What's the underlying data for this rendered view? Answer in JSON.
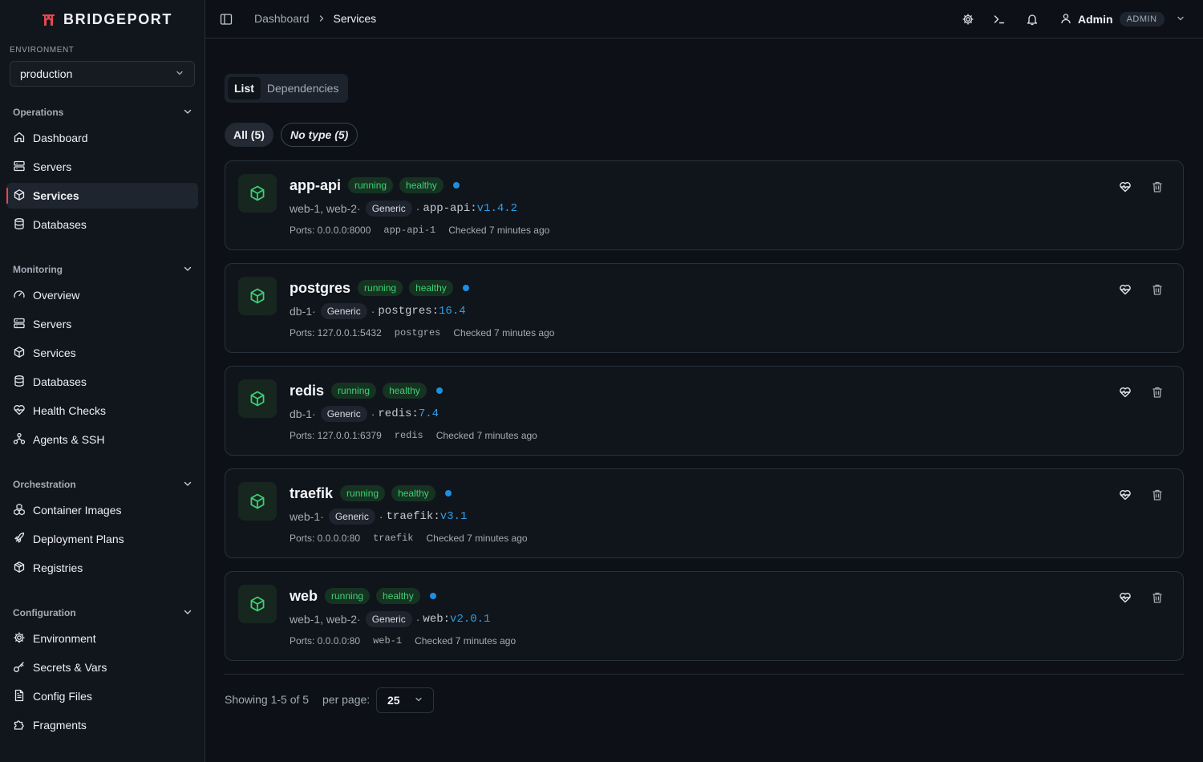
{
  "app": {
    "name": "BRIDGEPORT"
  },
  "environment": {
    "label": "ENVIRONMENT",
    "value": "production"
  },
  "sidebar": {
    "groups": [
      {
        "title": "Operations",
        "items": [
          "Dashboard",
          "Servers",
          "Services",
          "Databases"
        ]
      },
      {
        "title": "Monitoring",
        "items": [
          "Overview",
          "Servers",
          "Services",
          "Databases",
          "Health Checks",
          "Agents & SSH"
        ]
      },
      {
        "title": "Orchestration",
        "items": [
          "Container Images",
          "Deployment Plans",
          "Registries"
        ]
      },
      {
        "title": "Configuration",
        "items": [
          "Environment",
          "Secrets & Vars",
          "Config Files",
          "Fragments"
        ]
      }
    ],
    "active_item": "Services"
  },
  "header": {
    "breadcrumb": [
      "Dashboard",
      "Services"
    ],
    "user": {
      "name": "Admin",
      "role": "ADMIN"
    }
  },
  "view_tabs": [
    "List",
    "Dependencies"
  ],
  "filters": {
    "all": "All (5)",
    "no_type": "No type (5)"
  },
  "services": [
    {
      "name": "app-api",
      "status": "running",
      "health": "healthy",
      "servers": "web-1, web-2",
      "type": "Generic",
      "image": "app-api",
      "tag": "v1.4.2",
      "ports": "Ports: 0.0.0.0:8000",
      "container": "app-api-1",
      "checked": "Checked 7 minutes ago"
    },
    {
      "name": "postgres",
      "status": "running",
      "health": "healthy",
      "servers": "db-1",
      "type": "Generic",
      "image": "postgres",
      "tag": "16.4",
      "ports": "Ports: 127.0.0.1:5432",
      "container": "postgres",
      "checked": "Checked 7 minutes ago"
    },
    {
      "name": "redis",
      "status": "running",
      "health": "healthy",
      "servers": "db-1",
      "type": "Generic",
      "image": "redis",
      "tag": "7.4",
      "ports": "Ports: 127.0.0.1:6379",
      "container": "redis",
      "checked": "Checked 7 minutes ago"
    },
    {
      "name": "traefik",
      "status": "running",
      "health": "healthy",
      "servers": "web-1",
      "type": "Generic",
      "image": "traefik",
      "tag": "v3.1",
      "ports": "Ports: 0.0.0.0:80",
      "container": "traefik",
      "checked": "Checked 7 minutes ago"
    },
    {
      "name": "web",
      "status": "running",
      "health": "healthy",
      "servers": "web-1, web-2",
      "type": "Generic",
      "image": "web",
      "tag": "v2.0.1",
      "ports": "Ports: 0.0.0.0:80",
      "container": "web-1",
      "checked": "Checked 7 minutes ago"
    }
  ],
  "pagination": {
    "showing": "Showing 1-5 of 5",
    "per_page_label": "per page:",
    "per_page_value": "25"
  },
  "colors": {
    "accent": "#e5484d",
    "healthy_text": "#3ecf75",
    "healthy_bg": "#163322",
    "tag_blue": "#2e9ee8",
    "dot_blue": "#1d8fe1"
  },
  "icons": {
    "header": [
      "settings-icon",
      "terminal-icon",
      "bell-icon",
      "user-icon",
      "chevron-down-icon"
    ],
    "card_actions": [
      "heart-pulse-icon",
      "trash-icon"
    ],
    "service": "box-icon"
  }
}
